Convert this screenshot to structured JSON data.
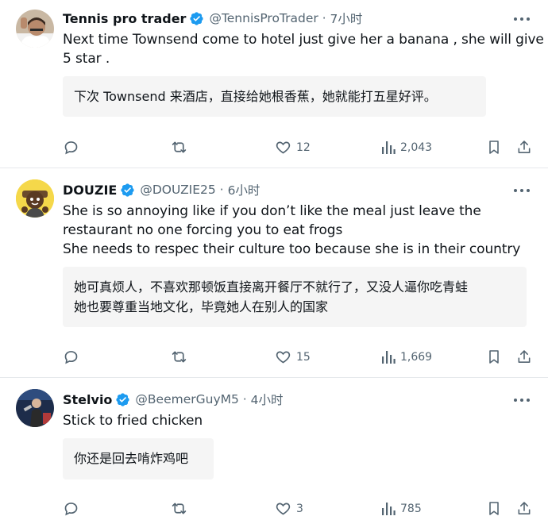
{
  "tweets": [
    {
      "name": "Tennis pro trader",
      "handle": "@TennisProTrader",
      "time": "7小时",
      "text_lines": [
        "Next time Townsend come to hotel just give her a banana , she will give",
        "5 star ."
      ],
      "translation_lines": [
        "下次 Townsend 来酒店，直接给她根香蕉，她就能打五星好评。"
      ],
      "likes": "12",
      "views": "2,043"
    },
    {
      "name": "DOUZIE",
      "handle": "@DOUZIE25",
      "time": "6小时",
      "text_lines": [
        "She is so annoying like if you don’t like the meal just leave the",
        "restaurant no one forcing you to eat frogs",
        "She needs to respec their culture too because she is in their country"
      ],
      "translation_lines": [
        "她可真烦人，不喜欢那顿饭直接离开餐厅不就行了，又没人逼你吃青蛙",
        "她也要尊重当地文化，毕竟她人在别人的国家"
      ],
      "likes": "15",
      "views": "1,669"
    },
    {
      "name": "Stelvio",
      "handle": "@BeemerGuyM5",
      "time": "4小时",
      "text_lines": [
        "Stick to fried chicken"
      ],
      "translation_lines": [
        "你还是回去啃炸鸡吧"
      ],
      "likes": "3",
      "views": "785"
    }
  ],
  "separator": "·",
  "colors": {
    "verified": "#1d9bf0",
    "secondary_text": "#536471",
    "translation_bg": "#f5f5f5"
  },
  "icons": [
    "reply-icon",
    "retweet-icon",
    "like-icon",
    "views-icon",
    "bookmark-icon",
    "share-icon",
    "verified-badge-icon",
    "more-options-icon"
  ]
}
